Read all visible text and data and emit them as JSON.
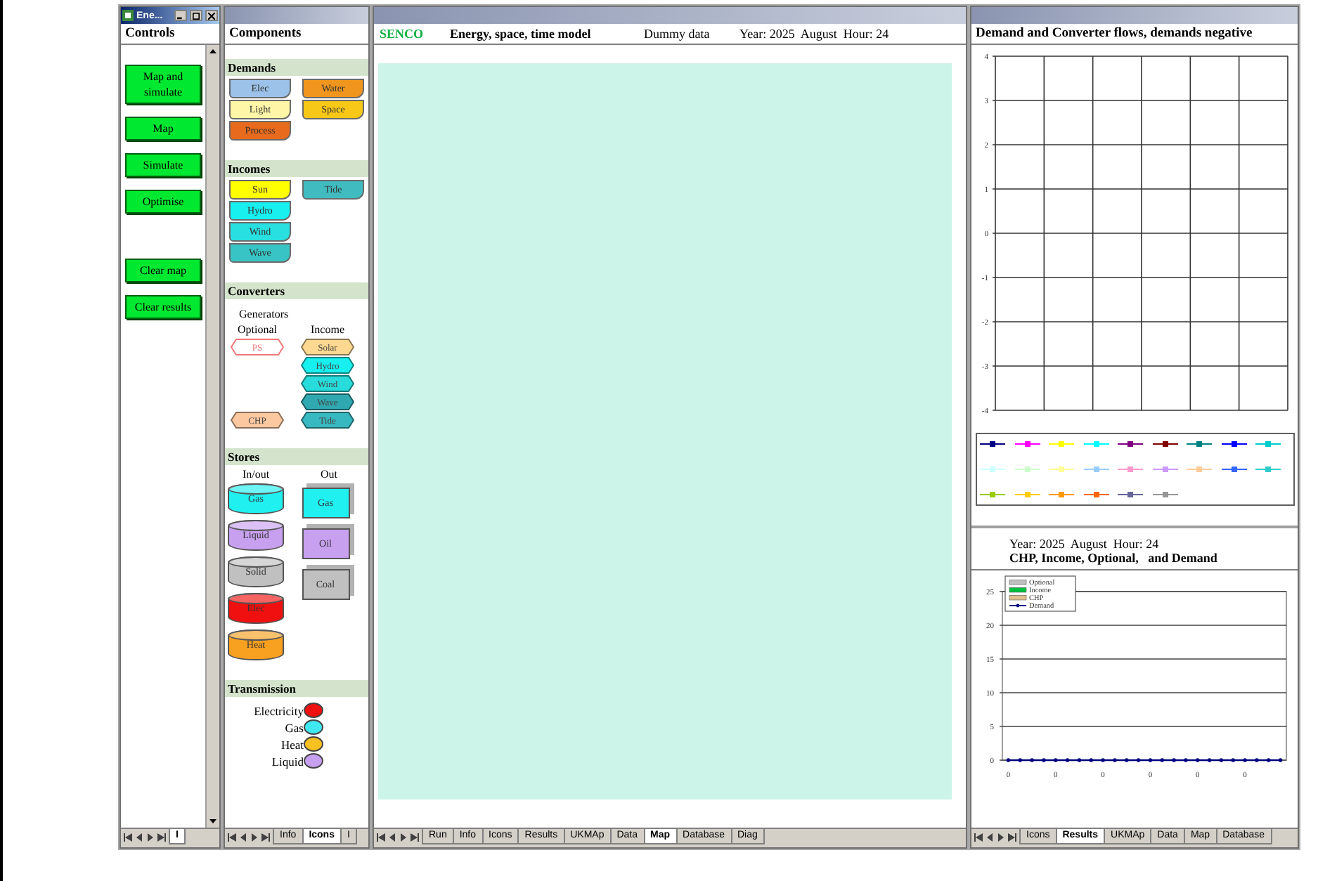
{
  "controls": {
    "active": true,
    "title": "Ene...",
    "header": "Controls",
    "button_groups": [
      [
        {
          "label": "Map and simulate"
        },
        {
          "label": "Map"
        },
        {
          "label": "Simulate"
        },
        {
          "label": "Optimise"
        }
      ],
      [
        {
          "label": "Clear map"
        },
        {
          "label": "Clear results"
        }
      ]
    ],
    "sheet_tabs": [
      {
        "label": "I",
        "selected": true
      }
    ]
  },
  "components": {
    "active": false,
    "header": "Components",
    "sections": [
      {
        "kind": "tags",
        "title": "Demands",
        "columns": [
          [
            {
              "label": "Elec",
              "color": "#9cc2ea"
            },
            {
              "label": "Light",
              "color": "#fff6a8"
            },
            {
              "label": "Process",
              "color": "#e86a1c"
            }
          ],
          [
            {
              "label": "Water",
              "color": "#f0961e"
            },
            {
              "label": "Space",
              "color": "#f8c818"
            }
          ]
        ]
      },
      {
        "kind": "tags",
        "title": "Incomes",
        "columns": [
          [
            {
              "label": "Sun",
              "color": "#ffff00"
            },
            {
              "label": "Hydro",
              "color": "#18f0f0"
            },
            {
              "label": "Wind",
              "color": "#28e0e0"
            },
            {
              "label": "Wave",
              "color": "#38c4c4"
            }
          ],
          [
            {
              "label": "Tide",
              "color": "#40bcc0"
            }
          ]
        ]
      },
      {
        "kind": "converters",
        "title": "Converters",
        "subtitle": "Generators",
        "columns": [
          {
            "heading": "Optional",
            "items": [
              {
                "label": "PS",
                "kind": "outlined",
                "color": "#f07878"
              },
              {
                "label": "CHP",
                "kind": "filled",
                "color": "#fcc8a0"
              }
            ]
          },
          {
            "heading": "Income",
            "items": [
              {
                "label": "Solar",
                "kind": "filled",
                "color": "#fcd890"
              },
              {
                "label": "Hydro",
                "kind": "filled",
                "color": "#18f0f0"
              },
              {
                "label": "Wind",
                "kind": "filled",
                "color": "#28dcdc"
              },
              {
                "label": "Wave",
                "kind": "filled",
                "color": "#30a8b0"
              },
              {
                "label": "Tide",
                "kind": "filled",
                "color": "#38b8c0"
              }
            ]
          }
        ]
      },
      {
        "kind": "stores",
        "title": "Stores",
        "columns": [
          {
            "heading": "In/out",
            "kind": "cylinder",
            "items": [
              {
                "label": "Gas",
                "color": "#20f0f0"
              },
              {
                "label": "Liquid",
                "color": "#c8a0f0"
              },
              {
                "label": "Solid",
                "color": "#c0c0c0"
              },
              {
                "label": "Elec",
                "color": "#f01010"
              },
              {
                "label": "Heat",
                "color": "#f8a020"
              }
            ]
          },
          {
            "heading": "Out",
            "kind": "cube",
            "items": [
              {
                "label": "Gas",
                "color": "#20f0f0"
              },
              {
                "label": "Oil",
                "color": "#c8a0f0"
              },
              {
                "label": "Coal",
                "color": "#c0c0c0"
              }
            ]
          }
        ]
      },
      {
        "kind": "transmission",
        "title": "Transmission",
        "items": [
          {
            "label": "Electricity",
            "color": "#f01010"
          },
          {
            "label": "Gas",
            "color": "#40e8f0"
          },
          {
            "label": "Heat",
            "color": "#f8c020"
          },
          {
            "label": "Liquid",
            "color": "#c8a0f0"
          }
        ]
      }
    ],
    "sheet_tabs": [
      {
        "label": "Info",
        "selected": false
      },
      {
        "label": "Icons",
        "selected": true
      },
      {
        "label": "I",
        "selected": false
      }
    ]
  },
  "main": {
    "active": false,
    "brand": "SENCO",
    "model_title": "Energy, space, time model",
    "note": "Dummy data",
    "time": "Year: 2025  August  Hour: 24",
    "sheet_tabs": [
      {
        "label": "Run",
        "selected": false
      },
      {
        "label": "Info",
        "selected": false
      },
      {
        "label": "Icons",
        "selected": false
      },
      {
        "label": "Results",
        "selected": false
      },
      {
        "label": "UKMAp",
        "selected": false
      },
      {
        "label": "Data",
        "selected": false
      },
      {
        "label": "Map",
        "selected": true
      },
      {
        "label": "Database",
        "selected": false
      },
      {
        "label": "Diag",
        "selected": false
      }
    ]
  },
  "results": {
    "active": false,
    "header": "Demand and Converter flows, demands negative",
    "flow_chart": {
      "chart_data": {
        "type": "line",
        "grid": true,
        "categories": [
          null,
          null,
          null,
          null,
          null,
          null
        ],
        "ylim": [
          -4,
          4
        ],
        "yticks": [
          -4,
          -3,
          -2,
          -1,
          0,
          1,
          2,
          3,
          4
        ]
      },
      "legend": [
        {
          "color": "#000080"
        },
        {
          "color": "#ff00ff"
        },
        {
          "color": "#ffff00"
        },
        {
          "color": "#00ffff"
        },
        {
          "color": "#800080"
        },
        {
          "color": "#800000"
        },
        {
          "color": "#008080"
        },
        {
          "color": "#0000ff"
        },
        {
          "color": "#00cccc"
        },
        {
          "color": "#ccffff"
        },
        {
          "color": "#ccffcc"
        },
        {
          "color": "#ffff99"
        },
        {
          "color": "#99ccff"
        },
        {
          "color": "#ff99cc"
        },
        {
          "color": "#cc99ff"
        },
        {
          "color": "#ffcc99"
        },
        {
          "color": "#3366ff"
        },
        {
          "color": "#33cccc"
        },
        {
          "color": "#99cc00"
        },
        {
          "color": "#ffcc00"
        },
        {
          "color": "#ff9900"
        },
        {
          "color": "#ff6600"
        },
        {
          "color": "#666699"
        },
        {
          "color": "#969696"
        }
      ]
    },
    "caption": "Year: 2025  August  Hour: 24",
    "supply_chart": {
      "chart_data": {
        "type": "line",
        "title": "CHP, Income, Optional,   and Demand",
        "grid": true,
        "ylim": [
          0,
          25
        ],
        "yticks": [
          0,
          5,
          10,
          15,
          20,
          25
        ],
        "categories": [
          "0",
          null,
          null,
          null,
          "0",
          null,
          null,
          null,
          "0",
          null,
          null,
          null,
          "0",
          null,
          null,
          null,
          "0",
          null,
          null,
          null,
          "0",
          null,
          null,
          null
        ],
        "series": [
          {
            "name": "Optional",
            "color": "#c0c0c0",
            "values": [
              null,
              null,
              null,
              null,
              null,
              null,
              null,
              null,
              null,
              null,
              null,
              null,
              null,
              null,
              null,
              null,
              null,
              null,
              null,
              null,
              null,
              null,
              null,
              null
            ]
          },
          {
            "name": "Income",
            "color": "#00c040",
            "values": [
              null,
              null,
              null,
              null,
              null,
              null,
              null,
              null,
              null,
              null,
              null,
              null,
              null,
              null,
              null,
              null,
              null,
              null,
              null,
              null,
              null,
              null,
              null,
              null
            ]
          },
          {
            "name": "CHP",
            "color": "#e0c090",
            "values": [
              null,
              null,
              null,
              null,
              null,
              null,
              null,
              null,
              null,
              null,
              null,
              null,
              null,
              null,
              null,
              null,
              null,
              null,
              null,
              null,
              null,
              null,
              null,
              null
            ]
          },
          {
            "name": "Demand",
            "color": "#000080",
            "values": [
              0,
              0,
              0,
              0,
              0,
              0,
              0,
              0,
              0,
              0,
              0,
              0,
              0,
              0,
              0,
              0,
              0,
              0,
              0,
              0,
              0,
              0,
              0,
              0
            ]
          }
        ]
      }
    },
    "sheet_tabs": [
      {
        "label": "Icons",
        "selected": false
      },
      {
        "label": "Results",
        "selected": true
      },
      {
        "label": "UKMAp",
        "selected": false
      },
      {
        "label": "Data",
        "selected": false
      },
      {
        "label": "Map",
        "selected": false
      },
      {
        "label": "Database",
        "selected": false
      }
    ]
  }
}
